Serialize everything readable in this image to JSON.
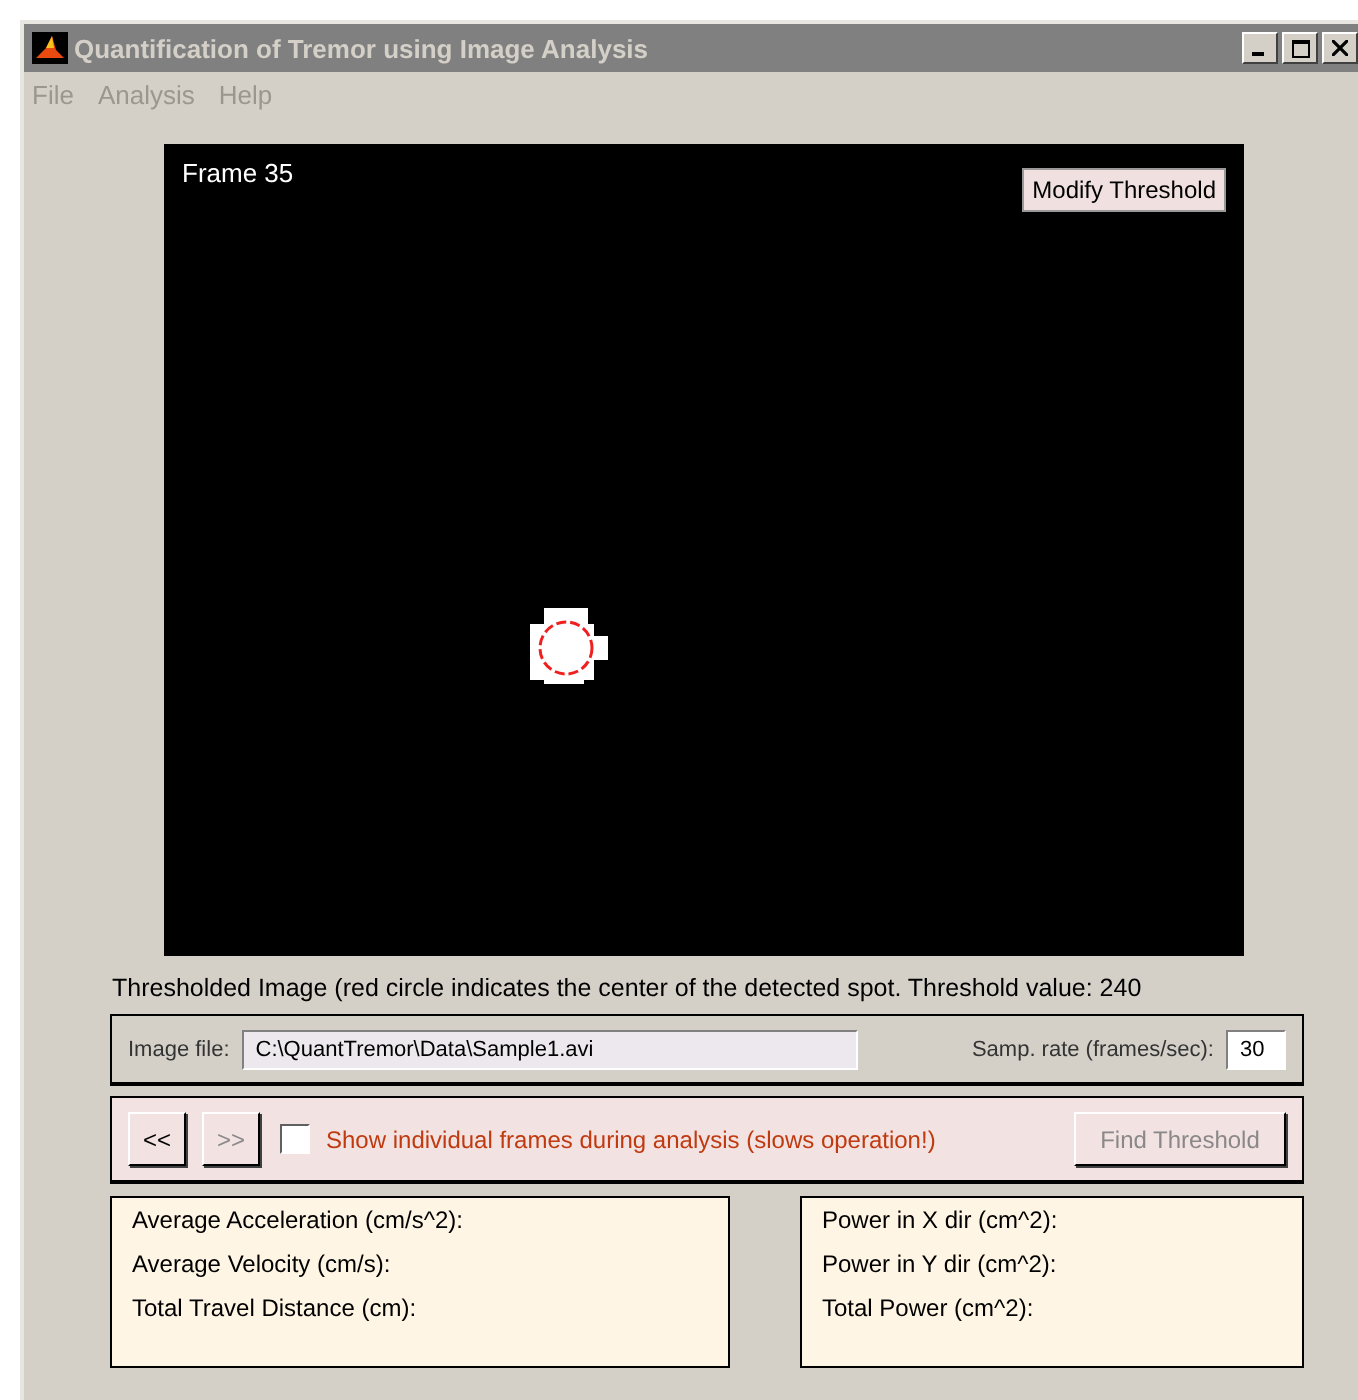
{
  "window": {
    "title": "Quantification of Tremor using Image Analysis",
    "active": false
  },
  "menu": [
    {
      "label": "File"
    },
    {
      "label": "Analysis"
    },
    {
      "label": "Help"
    }
  ],
  "display": {
    "frame_label": "Frame 35",
    "overlay_button": {
      "label": "Modify Threshold"
    },
    "kind": "picture"
  },
  "caption": "Thresholded Image (red circle indicates the center of the detected spot. Threshold value: 240",
  "file_panel": {
    "file_label": "Image file:",
    "file_value": "C:\\QuantTremor\\Data\\Sample1.avi",
    "rate_label": "Samp. rate (frames/sec):",
    "rate_value": "30"
  },
  "controls": {
    "buttons": [
      {
        "label": "<<",
        "disabled": false
      },
      {
        "label": ">>",
        "disabled": true
      }
    ],
    "checkbox": {
      "label": "Show individual frames during analysis (slows operation!)",
      "checked": false
    },
    "action": {
      "label": "Find Threshold",
      "disabled": true
    }
  },
  "results": [
    [
      "Average Acceleration (cm/s^2):",
      "Average Velocity (cm/s):",
      "Total Travel Distance (cm):"
    ],
    [
      "Power in X dir (cm^2):",
      "Power in Y dir (cm^2):",
      "Total Power (cm^2):"
    ]
  ]
}
